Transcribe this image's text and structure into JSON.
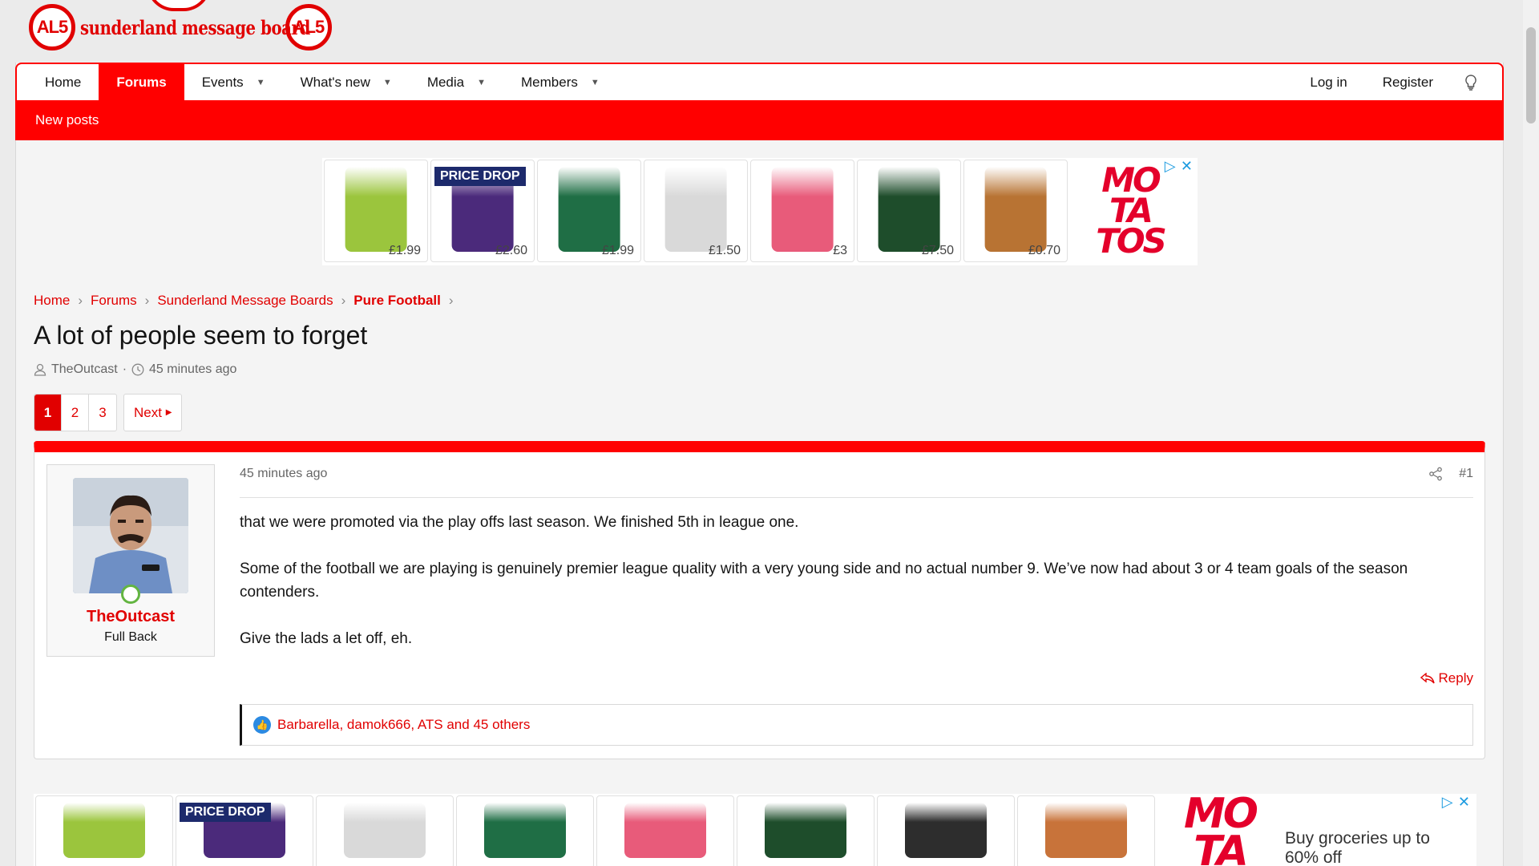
{
  "site": {
    "logo_text": "sunderland message board",
    "logo_badge": "AL5"
  },
  "nav": {
    "items": [
      {
        "label": "Home",
        "caret": false,
        "active": false
      },
      {
        "label": "Forums",
        "caret": false,
        "active": true
      },
      {
        "label": "Events",
        "caret": true,
        "active": false
      },
      {
        "label": "What's new",
        "caret": true,
        "active": false
      },
      {
        "label": "Media",
        "caret": true,
        "active": false
      },
      {
        "label": "Members",
        "caret": true,
        "active": false
      }
    ],
    "login": "Log in",
    "register": "Register",
    "subnav": "New posts"
  },
  "ad_top": {
    "tiles": [
      {
        "price": "£1.99",
        "badge": "",
        "color": "#9bc53d"
      },
      {
        "price": "£2.60",
        "badge": "PRICE DROP",
        "color": "#4b2a7b"
      },
      {
        "price": "£1.99",
        "badge": "",
        "color": "#1f6e45"
      },
      {
        "price": "£1.50",
        "badge": "",
        "color": "#d9d9d9"
      },
      {
        "price": "£3",
        "badge": "",
        "color": "#e85b7a"
      },
      {
        "price": "£7.50",
        "badge": "",
        "color": "#1e4d2b"
      },
      {
        "price": "£0.70",
        "badge": "",
        "color": "#b87333"
      }
    ],
    "brand": [
      "MO",
      "TA",
      "TOS"
    ]
  },
  "breadcrumb": [
    "Home",
    "Forums",
    "Sunderland Message Boards",
    "Pure Football"
  ],
  "thread": {
    "title": "A lot of people seem to forget",
    "author": "TheOutcast",
    "time": "45 minutes ago"
  },
  "pagination": {
    "pages": [
      "1",
      "2",
      "3"
    ],
    "current": "1",
    "next": "Next"
  },
  "post": {
    "username": "TheOutcast",
    "user_title": "Full Back",
    "time": "45 minutes ago",
    "number": "#1",
    "paragraphs": [
      "that we were promoted via the play offs last season. We finished 5th in league one.",
      "Some of the football we are playing is genuinely premier league quality with a very young side and no actual number 9. We’ve now had about 3 or 4 team goals of the season contenders.",
      "Give the lads a let off, eh."
    ],
    "reply": "Reply",
    "likes": "Barbarella, damok666, ATS and 45 others"
  },
  "ad_bottom": {
    "tiles": [
      {
        "badge": "",
        "color": "#9bc53d"
      },
      {
        "badge": "PRICE DROP",
        "color": "#4b2a7b"
      },
      {
        "badge": "",
        "color": "#d9d9d9"
      },
      {
        "badge": "",
        "color": "#1f6e45"
      },
      {
        "badge": "",
        "color": "#e85b7a"
      },
      {
        "badge": "",
        "color": "#1e4d2b"
      },
      {
        "badge": "",
        "color": "#2d2d2d"
      },
      {
        "badge": "",
        "color": "#c8733a"
      }
    ],
    "brand": [
      "MO",
      "TA"
    ],
    "text": "Buy groceries up to 60% off"
  }
}
